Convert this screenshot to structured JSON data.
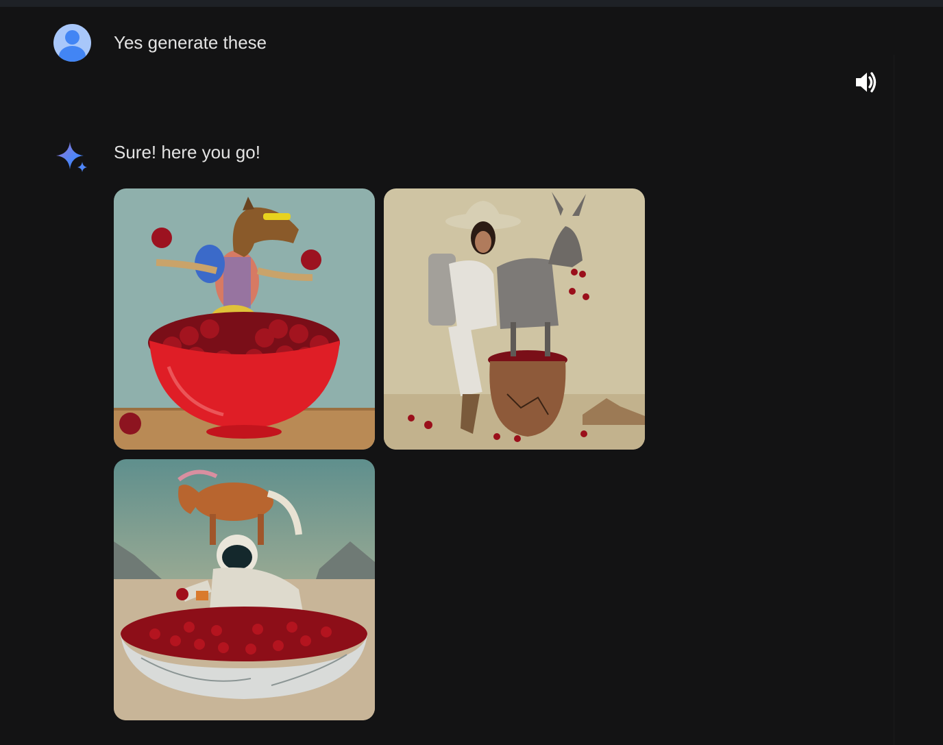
{
  "conversation": {
    "user_message": "Yes generate these",
    "assistant_message": "Sure! here you go!",
    "icons": {
      "user_avatar": "person-avatar-icon",
      "assistant": "gemini-sparkle-icon",
      "read_aloud": "speaker-icon"
    },
    "images": [
      {
        "id": "image-1",
        "subject": "horse-juggling-cherries"
      },
      {
        "id": "image-2",
        "subject": "astronaut-cowgirl-with-donkey"
      },
      {
        "id": "image-3",
        "subject": "horse-on-astronaut-with-cherries"
      }
    ]
  },
  "colors": {
    "background": "#131314",
    "text": "#e3e3e3",
    "avatar_bg": "#a8c7fa",
    "avatar_fg": "#4285f4"
  }
}
